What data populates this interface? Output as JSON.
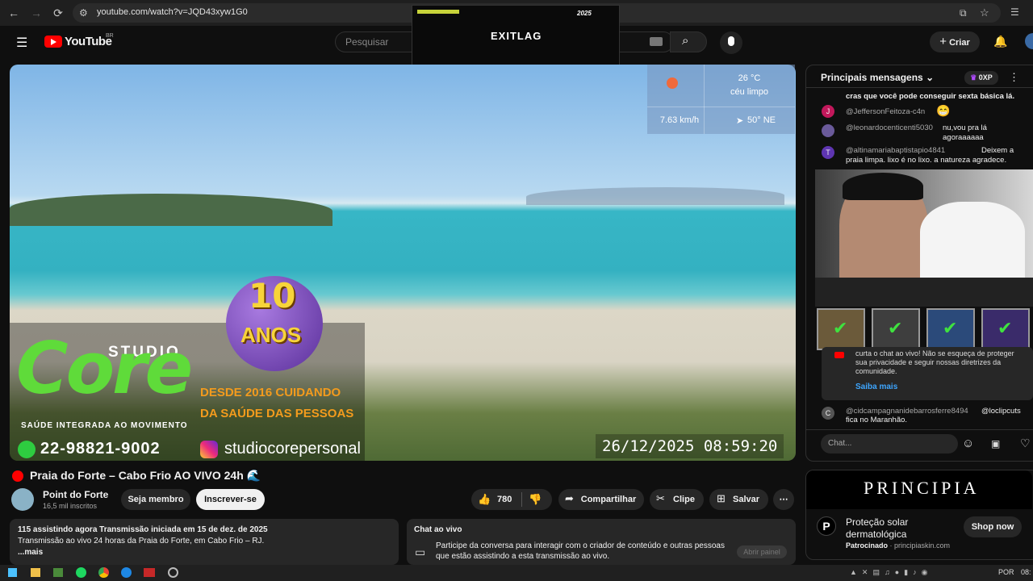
{
  "browser": {
    "url": "youtube.com/watch?v=JQD43xyw1G0"
  },
  "overlay": {
    "brand": "EXITLAG",
    "badge": "2025"
  },
  "header": {
    "logo": "YouTube",
    "region": "BR",
    "search_placeholder": "Pesquisar",
    "create_label": "Criar"
  },
  "video": {
    "weather_temp": "26 °C",
    "weather_desc": "céu limpo",
    "wind_speed": "7.63 km/h",
    "wind_dir": "50° NE",
    "banner_years": "10",
    "banner_years_label": "ANOS",
    "studio_label": "STUDIO",
    "brand_name": "Core",
    "brand_tagline": "SAÚDE INTEGRADA AO MOVIMENTO",
    "since_line1": "DESDE 2016 CUIDANDO",
    "since_line2": "DA SAÚDE DAS PESSOAS",
    "phone": "22-98821-9002",
    "instagram": "studiocorepersonal",
    "timestamp": "26/12/2025 08:59:20"
  },
  "watch": {
    "title": "Praia do Forte – Cabo Frio AO VIVO 24h 🌊",
    "channel_name": "Point do Forte",
    "subscribers": "16,5 mil inscritos",
    "join_label": "Seja membro",
    "subscribe_label": "Inscrever-se",
    "likes": "780",
    "share_label": "Compartilhar",
    "clip_label": "Clipe",
    "save_label": "Salvar"
  },
  "description": {
    "stats": "115 assistindo agora  Transmissão iniciada em 15 de dez. de 2025",
    "text": "Transmissão ao vivo 24 horas da Praia do Forte, em Cabo Frio – RJ.",
    "more": "...mais"
  },
  "live_chat_info": {
    "title": "Chat ao vivo",
    "text": "Participe da conversa para interagir com o criador de conteúdo e outras pessoas que estão assistindo a esta transmissão ao vivo.",
    "button": "Abrir painel"
  },
  "chat": {
    "header": "Principais mensagens",
    "xp": "0XP",
    "messages": [
      {
        "author": "",
        "text": "cras que você pode conseguir sexta básica lá."
      },
      {
        "author": "@JeffersonFeitoza-c4n",
        "text": "😁"
      },
      {
        "author": "@leonardocenticenti5030",
        "text": "nu,vou pra lá agoraaaaaa"
      },
      {
        "author": "@altinamariabaptistapio4841",
        "text": "Deixem a praia limpa. lixo é no lixo. a natureza agradece."
      },
      {
        "author": "@cidcampagnanidebarrosferre8494",
        "text": "@loclipcuts fica no Maranhão."
      }
    ],
    "notice": "curta o chat ao vivo! Não se esqueça de proteger sua privacidade e seguir nossas diretrizes da comunidade.",
    "notice_link": "Saiba mais",
    "input_placeholder": "Chat...",
    "avatars": [
      "J",
      "T",
      "C"
    ]
  },
  "ad": {
    "brand": "PRINCIPIA",
    "title": "Proteção solar dermatológica",
    "sponsored": "Patrocinado",
    "domain": "principiaskin.com",
    "cta": "Shop now",
    "logo_letter": "P"
  },
  "taskbar": {
    "lang": "POR",
    "time": "08:"
  },
  "colors": {
    "accent_red": "#ff0000",
    "link_blue": "#3ea6ff",
    "panel_bg": "#0f0f0f"
  }
}
